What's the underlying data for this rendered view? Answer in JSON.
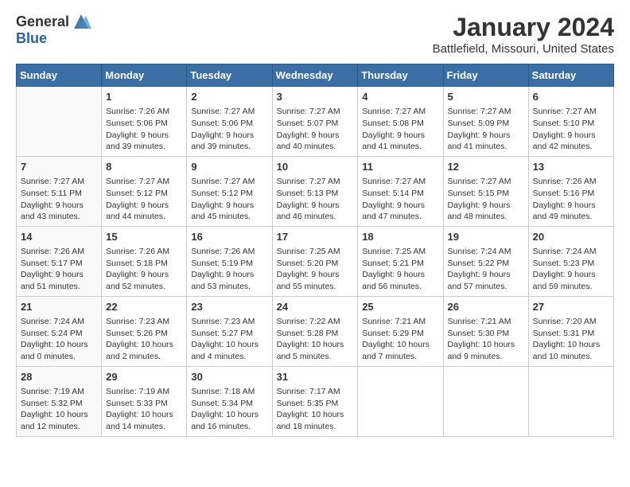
{
  "header": {
    "logo_general": "General",
    "logo_blue": "Blue",
    "title": "January 2024",
    "subtitle": "Battlefield, Missouri, United States"
  },
  "calendar": {
    "days_of_week": [
      "Sunday",
      "Monday",
      "Tuesday",
      "Wednesday",
      "Thursday",
      "Friday",
      "Saturday"
    ],
    "weeks": [
      [
        {
          "day": "",
          "sunrise": "",
          "sunset": "",
          "daylight": ""
        },
        {
          "day": "1",
          "sunrise": "Sunrise: 7:26 AM",
          "sunset": "Sunset: 5:06 PM",
          "daylight": "Daylight: 9 hours and 39 minutes."
        },
        {
          "day": "2",
          "sunrise": "Sunrise: 7:27 AM",
          "sunset": "Sunset: 5:06 PM",
          "daylight": "Daylight: 9 hours and 39 minutes."
        },
        {
          "day": "3",
          "sunrise": "Sunrise: 7:27 AM",
          "sunset": "Sunset: 5:07 PM",
          "daylight": "Daylight: 9 hours and 40 minutes."
        },
        {
          "day": "4",
          "sunrise": "Sunrise: 7:27 AM",
          "sunset": "Sunset: 5:08 PM",
          "daylight": "Daylight: 9 hours and 41 minutes."
        },
        {
          "day": "5",
          "sunrise": "Sunrise: 7:27 AM",
          "sunset": "Sunset: 5:09 PM",
          "daylight": "Daylight: 9 hours and 41 minutes."
        },
        {
          "day": "6",
          "sunrise": "Sunrise: 7:27 AM",
          "sunset": "Sunset: 5:10 PM",
          "daylight": "Daylight: 9 hours and 42 minutes."
        }
      ],
      [
        {
          "day": "7",
          "sunrise": "Sunrise: 7:27 AM",
          "sunset": "Sunset: 5:11 PM",
          "daylight": "Daylight: 9 hours and 43 minutes."
        },
        {
          "day": "8",
          "sunrise": "Sunrise: 7:27 AM",
          "sunset": "Sunset: 5:12 PM",
          "daylight": "Daylight: 9 hours and 44 minutes."
        },
        {
          "day": "9",
          "sunrise": "Sunrise: 7:27 AM",
          "sunset": "Sunset: 5:12 PM",
          "daylight": "Daylight: 9 hours and 45 minutes."
        },
        {
          "day": "10",
          "sunrise": "Sunrise: 7:27 AM",
          "sunset": "Sunset: 5:13 PM",
          "daylight": "Daylight: 9 hours and 46 minutes."
        },
        {
          "day": "11",
          "sunrise": "Sunrise: 7:27 AM",
          "sunset": "Sunset: 5:14 PM",
          "daylight": "Daylight: 9 hours and 47 minutes."
        },
        {
          "day": "12",
          "sunrise": "Sunrise: 7:27 AM",
          "sunset": "Sunset: 5:15 PM",
          "daylight": "Daylight: 9 hours and 48 minutes."
        },
        {
          "day": "13",
          "sunrise": "Sunrise: 7:26 AM",
          "sunset": "Sunset: 5:16 PM",
          "daylight": "Daylight: 9 hours and 49 minutes."
        }
      ],
      [
        {
          "day": "14",
          "sunrise": "Sunrise: 7:26 AM",
          "sunset": "Sunset: 5:17 PM",
          "daylight": "Daylight: 9 hours and 51 minutes."
        },
        {
          "day": "15",
          "sunrise": "Sunrise: 7:26 AM",
          "sunset": "Sunset: 5:18 PM",
          "daylight": "Daylight: 9 hours and 52 minutes."
        },
        {
          "day": "16",
          "sunrise": "Sunrise: 7:26 AM",
          "sunset": "Sunset: 5:19 PM",
          "daylight": "Daylight: 9 hours and 53 minutes."
        },
        {
          "day": "17",
          "sunrise": "Sunrise: 7:25 AM",
          "sunset": "Sunset: 5:20 PM",
          "daylight": "Daylight: 9 hours and 55 minutes."
        },
        {
          "day": "18",
          "sunrise": "Sunrise: 7:25 AM",
          "sunset": "Sunset: 5:21 PM",
          "daylight": "Daylight: 9 hours and 56 minutes."
        },
        {
          "day": "19",
          "sunrise": "Sunrise: 7:24 AM",
          "sunset": "Sunset: 5:22 PM",
          "daylight": "Daylight: 9 hours and 57 minutes."
        },
        {
          "day": "20",
          "sunrise": "Sunrise: 7:24 AM",
          "sunset": "Sunset: 5:23 PM",
          "daylight": "Daylight: 9 hours and 59 minutes."
        }
      ],
      [
        {
          "day": "21",
          "sunrise": "Sunrise: 7:24 AM",
          "sunset": "Sunset: 5:24 PM",
          "daylight": "Daylight: 10 hours and 0 minutes."
        },
        {
          "day": "22",
          "sunrise": "Sunrise: 7:23 AM",
          "sunset": "Sunset: 5:26 PM",
          "daylight": "Daylight: 10 hours and 2 minutes."
        },
        {
          "day": "23",
          "sunrise": "Sunrise: 7:23 AM",
          "sunset": "Sunset: 5:27 PM",
          "daylight": "Daylight: 10 hours and 4 minutes."
        },
        {
          "day": "24",
          "sunrise": "Sunrise: 7:22 AM",
          "sunset": "Sunset: 5:28 PM",
          "daylight": "Daylight: 10 hours and 5 minutes."
        },
        {
          "day": "25",
          "sunrise": "Sunrise: 7:21 AM",
          "sunset": "Sunset: 5:29 PM",
          "daylight": "Daylight: 10 hours and 7 minutes."
        },
        {
          "day": "26",
          "sunrise": "Sunrise: 7:21 AM",
          "sunset": "Sunset: 5:30 PM",
          "daylight": "Daylight: 10 hours and 9 minutes."
        },
        {
          "day": "27",
          "sunrise": "Sunrise: 7:20 AM",
          "sunset": "Sunset: 5:31 PM",
          "daylight": "Daylight: 10 hours and 10 minutes."
        }
      ],
      [
        {
          "day": "28",
          "sunrise": "Sunrise: 7:19 AM",
          "sunset": "Sunset: 5:32 PM",
          "daylight": "Daylight: 10 hours and 12 minutes."
        },
        {
          "day": "29",
          "sunrise": "Sunrise: 7:19 AM",
          "sunset": "Sunset: 5:33 PM",
          "daylight": "Daylight: 10 hours and 14 minutes."
        },
        {
          "day": "30",
          "sunrise": "Sunrise: 7:18 AM",
          "sunset": "Sunset: 5:34 PM",
          "daylight": "Daylight: 10 hours and 16 minutes."
        },
        {
          "day": "31",
          "sunrise": "Sunrise: 7:17 AM",
          "sunset": "Sunset: 5:35 PM",
          "daylight": "Daylight: 10 hours and 18 minutes."
        },
        {
          "day": "",
          "sunrise": "",
          "sunset": "",
          "daylight": ""
        },
        {
          "day": "",
          "sunrise": "",
          "sunset": "",
          "daylight": ""
        },
        {
          "day": "",
          "sunrise": "",
          "sunset": "",
          "daylight": ""
        }
      ]
    ]
  }
}
